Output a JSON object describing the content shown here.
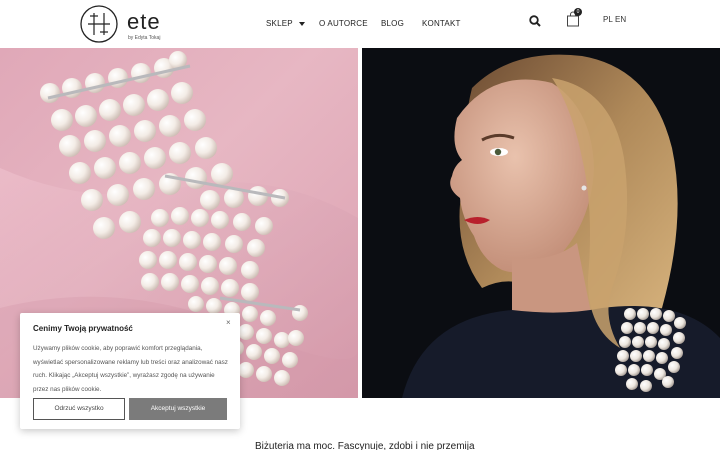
{
  "brand": {
    "name": "ete",
    "subtitle": "by Edyta Tokaj"
  },
  "nav": {
    "sklep": "SKLEP",
    "o_autorce": "O AUTORCE",
    "blog": "BLOG",
    "kontakt": "KONTAKT"
  },
  "header": {
    "cart_count": "0",
    "lang_pl": "PL",
    "lang_en": "EN"
  },
  "cookie": {
    "title": "Cenimy Twoją prywatność",
    "close": "×",
    "text": "Używamy plików cookie, aby poprawić komfort przeglądania, wyświetlać spersonalizowane reklamy lub treści oraz analizować nasz ruch. Klikając „Akceptuj wszystkie”, wyrażasz zgodę na używanie przez nas plików cookie.",
    "reject_label": "Odrzuć wszystko",
    "accept_label": "Akceptuj wszystkie"
  },
  "tagline": "Biżuteria ma moc. Fascynuje, zdobi i nie przemija"
}
